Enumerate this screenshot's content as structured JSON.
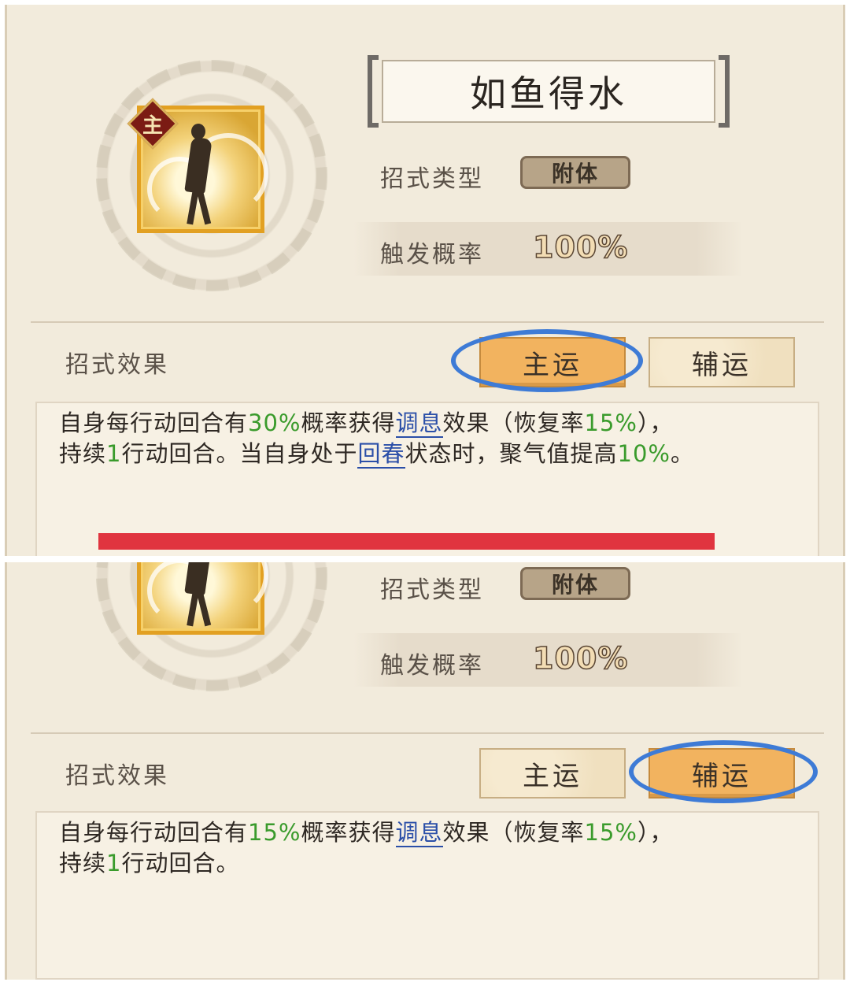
{
  "top": {
    "skill_name": "如鱼得水",
    "badge": "主",
    "type_label": "招式类型",
    "type_value": "附体",
    "rate_label": "触发概率",
    "rate_value": "100%",
    "effect_label": "招式效果",
    "btn_main": "主运",
    "btn_aux": "辅运",
    "active_tab": "主运",
    "desc": {
      "p1": "自身每行动回合有",
      "v1": "30%",
      "p2": "概率获得",
      "link1": "调息",
      "p3": "效果（恢复率",
      "v2": "15%",
      "p4": "），",
      "p5": "持续",
      "v3": "1",
      "p6": "行动回合。当自身处于",
      "link2": "回春",
      "p7": "状态时，聚气值提高",
      "v4": "10%",
      "p8": "。"
    }
  },
  "bottom": {
    "type_label": "招式类型",
    "type_value": "附体",
    "rate_label": "触发概率",
    "rate_value": "100%",
    "effect_label": "招式效果",
    "btn_main": "主运",
    "btn_aux": "辅运",
    "active_tab": "辅运",
    "desc": {
      "p1": "自身每行动回合有",
      "v1": "15%",
      "p2": "概率获得",
      "link1": "调息",
      "p3": "效果（恢复率",
      "v2": "15%",
      "p4": "），",
      "p5": "持续",
      "v3": "1",
      "p6": "行动回合。"
    }
  },
  "colors": {
    "panel_bg": "#f2ebdc",
    "active_button": "#f2b35f",
    "highlight_oval": "#3e7bd6",
    "value_green": "#3a9b2c",
    "link_blue": "#2b4fa8",
    "separator_bar": "#e0343f"
  }
}
